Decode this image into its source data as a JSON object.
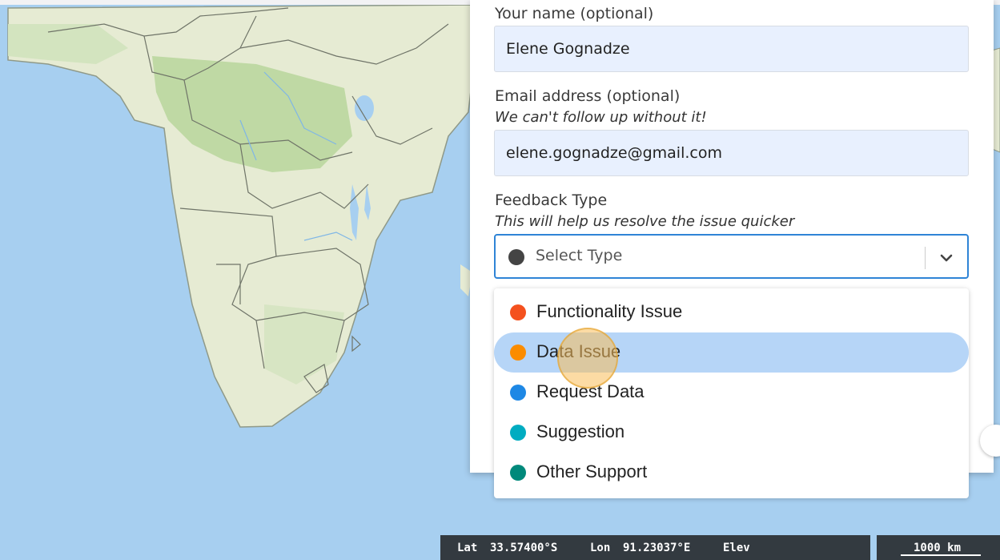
{
  "form": {
    "name_label": "Your name (optional)",
    "name_value": "Elene Gognadze",
    "email_label": "Email address (optional)",
    "email_hint": "We can't follow up without it!",
    "email_value": "elene.gognadze@gmail.com",
    "type_label": "Feedback Type",
    "type_hint": "This will help us resolve the issue quicker",
    "type_placeholder": "Select Type",
    "type_placeholder_color": "#444444"
  },
  "dropdown": {
    "options": [
      {
        "label": "Functionality Issue",
        "color": "#f4511e"
      },
      {
        "label": "Data Issue",
        "color": "#fb8c00",
        "highlighted": true
      },
      {
        "label": "Request Data",
        "color": "#1e88e5"
      },
      {
        "label": "Suggestion",
        "color": "#00acc1"
      },
      {
        "label": "Other Support",
        "color": "#00897b"
      }
    ]
  },
  "status": {
    "lat_label": "Lat",
    "lat_value": "33.57400°S",
    "lon_label": "Lon",
    "lon_value": "91.23037°E",
    "elev_label": "Elev",
    "scale_label": "1000 km"
  },
  "colors": {
    "ocean": "#a7cff0",
    "land": "#e6ebd3",
    "forest": "#bfd9a4",
    "accent": "#2f84d6",
    "highlight": "#b6d5f7"
  }
}
